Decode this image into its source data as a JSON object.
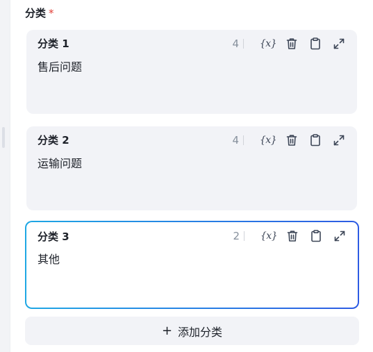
{
  "section": {
    "label": "分类",
    "required_mark": "*"
  },
  "categories": [
    {
      "title": "分类 1",
      "content": "售后问题",
      "count": "4",
      "active": false
    },
    {
      "title": "分类 2",
      "content": "运输问题",
      "count": "4",
      "active": false
    },
    {
      "title": "分类 3",
      "content": "其他",
      "count": "2",
      "active": true
    }
  ],
  "toolbar": {
    "variable_icon_text": "{x}",
    "icons": [
      "variable-icon",
      "trash-icon",
      "clipboard-icon",
      "expand-icon"
    ]
  },
  "add_button": {
    "icon": "+",
    "label": "添加分类"
  },
  "colors": {
    "active_border_start": "#1ea7e4",
    "active_border_end": "#2d5be3",
    "required": "#e03e36",
    "card_bg": "#f2f3f7"
  }
}
